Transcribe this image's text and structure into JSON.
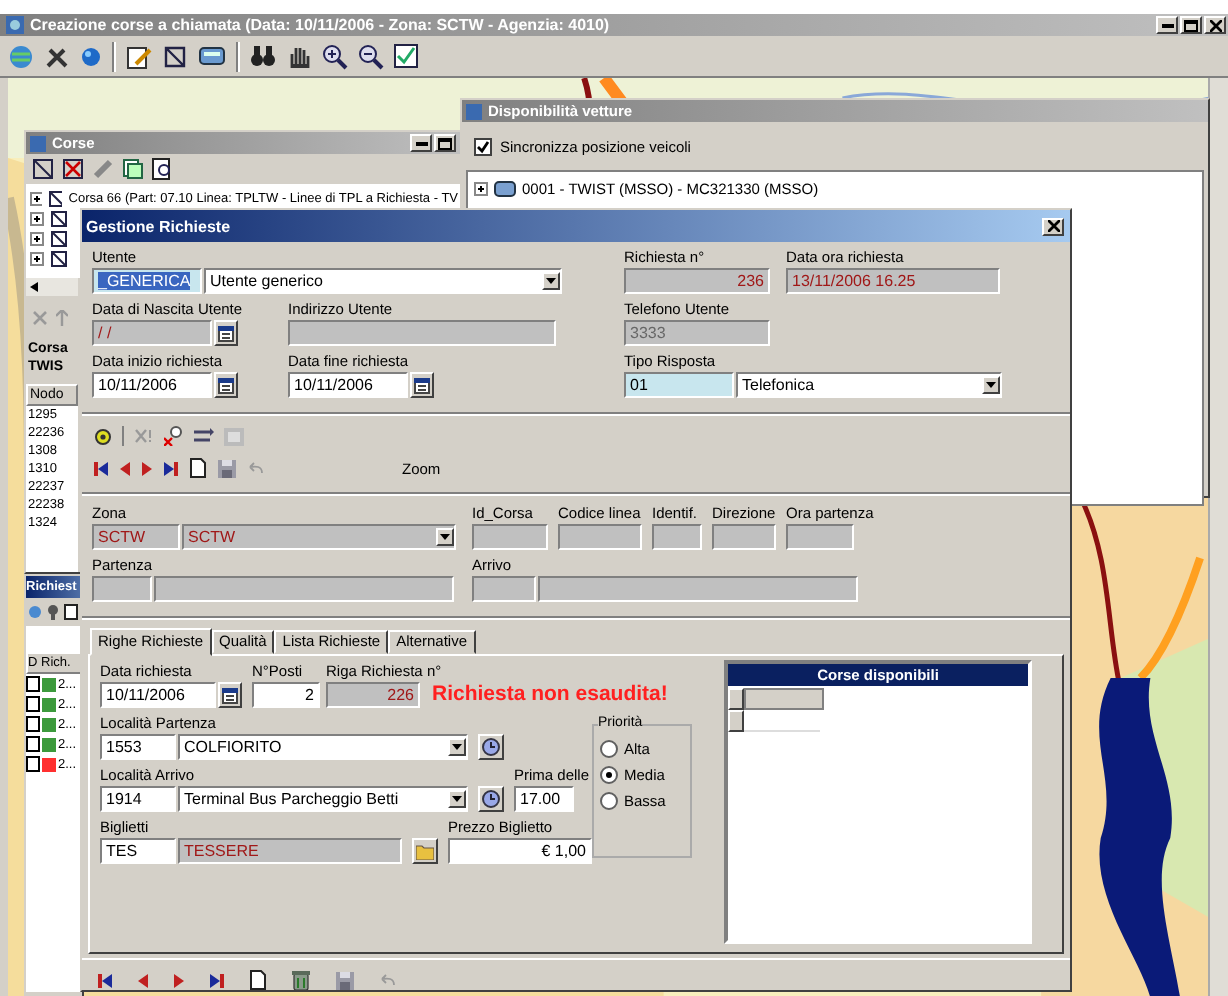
{
  "app": {
    "title": "Creazione corse a chiamata (Data: 10/11/2006 - Zona: SCTW - Agenzia: 4010)"
  },
  "corse_window": {
    "title": "Corse",
    "tree_row": "Corsa 66 (Part: 07.10 Linea: TPLTW - Linee di TPL a Richiesta - TV",
    "trip_labels": [
      "Corsa",
      "TWIS"
    ],
    "nodes_header": "Nodo",
    "nodes": [
      "1295",
      "22236",
      "1308",
      "1310",
      "22237",
      "22238",
      "1324"
    ]
  },
  "richieste_window": {
    "title": "Richiest",
    "column": "D Rich.",
    "rows": [
      {
        "text": "2...",
        "color": "#3c9a3c",
        "checked": false
      },
      {
        "text": "2...",
        "color": "#3c9a3c",
        "checked": false
      },
      {
        "text": "2...",
        "color": "#3c9a3c",
        "checked": false
      },
      {
        "text": "2...",
        "color": "#3c9a3c",
        "checked": false
      },
      {
        "text": "2...",
        "color": "#ff3030",
        "checked": false
      }
    ]
  },
  "vetture_window": {
    "title": "Disponibilità vetture",
    "sync": {
      "label": "Sincronizza posizione veicoli",
      "checked": true
    },
    "vehicles": [
      "0001 - TWIST (MSSO) - MC321330 (MSSO)"
    ]
  },
  "dialog": {
    "title": "Gestione Richieste",
    "utente": {
      "label": "Utente",
      "code": "_GENERICA",
      "name": "Utente generico"
    },
    "richiesta_n": {
      "label": "Richiesta n°",
      "value": "236"
    },
    "data_ora": {
      "label": "Data ora richiesta",
      "value": "13/11/2006 16.25"
    },
    "data_nascita": {
      "label": "Data di Nascita Utente",
      "value": "/ /"
    },
    "indirizzo": {
      "label": "Indirizzo Utente"
    },
    "telefono": {
      "label": "Telefono Utente",
      "value": "3333"
    },
    "data_inizio": {
      "label": "Data inizio richiesta",
      "value": "10/11/2006"
    },
    "data_fine": {
      "label": "Data fine richiesta",
      "value": "10/11/2006"
    },
    "tipo_risposta": {
      "label": "Tipo Risposta",
      "code": "01",
      "name": "Telefonica"
    },
    "zoom_label": "Zoom",
    "zona": {
      "label": "Zona",
      "code": "SCTW",
      "name": "SCTW"
    },
    "trip_fields": [
      "Id_Corsa",
      "Codice linea",
      "Identif.",
      "Direzione",
      "Ora partenza"
    ],
    "partenza": {
      "label": "Partenza"
    },
    "arrivo": {
      "label": "Arrivo"
    },
    "tabs": [
      {
        "label": "Righe Richieste",
        "selected": true
      },
      {
        "label": "Qualità",
        "selected": false
      },
      {
        "label": "Lista Richieste",
        "selected": false
      },
      {
        "label": "Alternative",
        "selected": false
      }
    ],
    "riga": {
      "data_richiesta": {
        "label": "Data richiesta",
        "value": "10/11/2006"
      },
      "posti": {
        "label": "N°Posti",
        "value": "2"
      },
      "riga_n": {
        "label": "Riga Richiesta n°",
        "value": "226"
      },
      "alert": "Richiesta non esaudita!",
      "partenza": {
        "label": "Località Partenza",
        "code": "1553",
        "name": "COLFIORITO"
      },
      "arrivo": {
        "label": "Località Arrivo",
        "code": "1914",
        "name": "Terminal Bus Parcheggio Betti"
      },
      "prima_delle": {
        "label": "Prima delle",
        "value": "17.00"
      },
      "biglietti": {
        "label": "Biglietti",
        "code": "TES",
        "name": "TESSERE"
      },
      "prezzo": {
        "label": "Prezzo Biglietto",
        "value": "€ 1,00"
      },
      "priorita": {
        "label": "Priorità",
        "options": [
          {
            "label": "Alta",
            "selected": false
          },
          {
            "label": "Media",
            "selected": true
          },
          {
            "label": "Bassa",
            "selected": false
          }
        ]
      },
      "corse_disponibili": {
        "title": "Corse disponibili"
      }
    }
  }
}
